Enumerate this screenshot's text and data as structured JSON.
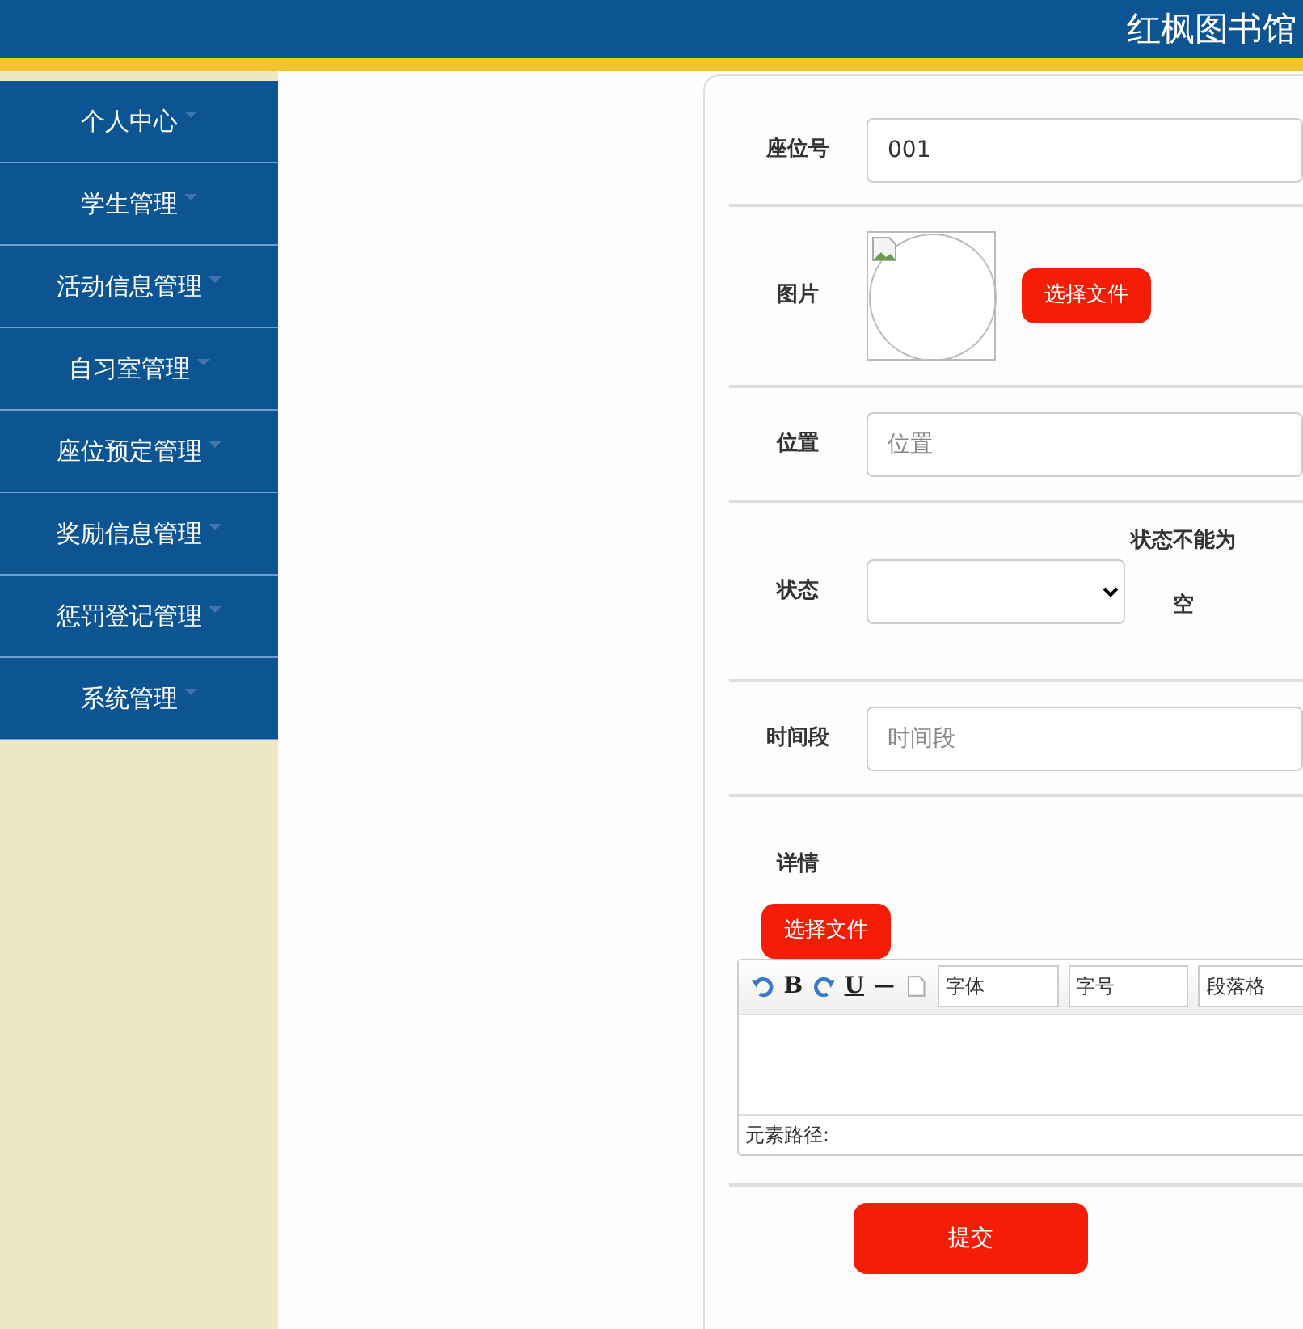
{
  "header": {
    "title": "红枫图书馆"
  },
  "sidebar": {
    "items": [
      {
        "label": "个人中心"
      },
      {
        "label": "学生管理"
      },
      {
        "label": "活动信息管理"
      },
      {
        "label": "自习室管理"
      },
      {
        "label": "座位预定管理"
      },
      {
        "label": "奖励信息管理"
      },
      {
        "label": "惩罚登记管理"
      },
      {
        "label": "系统管理"
      }
    ]
  },
  "form": {
    "fields": [
      {
        "kind": "text",
        "label": "座位号",
        "value": "001"
      },
      {
        "kind": "image",
        "label": "图片",
        "button": "选择文件"
      },
      {
        "kind": "text",
        "label": "位置",
        "placeholder": "位置"
      },
      {
        "kind": "select",
        "label": "状态",
        "error": "状态不能为空"
      },
      {
        "kind": "text",
        "label": "时间段",
        "placeholder": "时间段"
      },
      {
        "kind": "editor",
        "label": "详情",
        "button": "选择文件",
        "toolbar": {
          "bold": "B",
          "underline": "U",
          "selects": [
            "字体",
            "字号",
            "段落格"
          ]
        },
        "status": "元素路径:"
      }
    ],
    "submit": "提交"
  }
}
